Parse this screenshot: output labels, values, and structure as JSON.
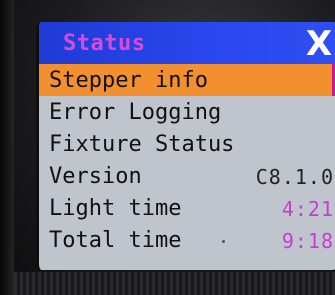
{
  "screen": {
    "title": "Status",
    "close_symbol": "X",
    "accent_color": "#c43ed0",
    "selected_color": "#f28f2e",
    "title_bar_color": "#2948ee"
  },
  "menu": {
    "items": [
      {
        "label": "Stepper info",
        "selected": true
      },
      {
        "label": "Error Logging"
      },
      {
        "label": "Fixture Status"
      },
      {
        "label": "Version",
        "value": "C8.1.0"
      },
      {
        "label": "Light time",
        "value": "4:21"
      },
      {
        "label": "Total time",
        "value": "9:18"
      }
    ]
  }
}
